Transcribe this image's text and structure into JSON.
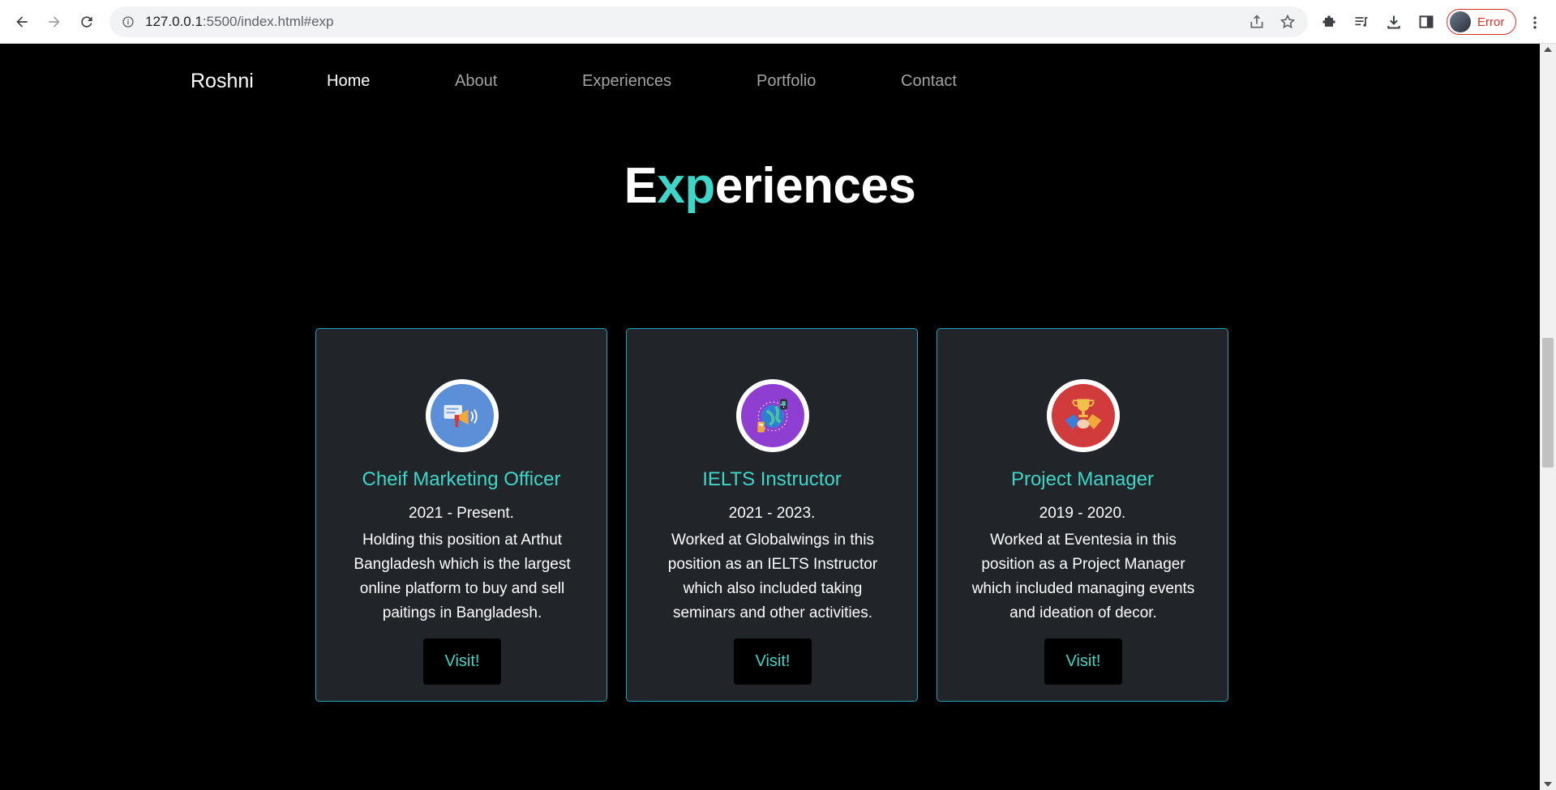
{
  "browser": {
    "url_host": "127.0.0.1",
    "url_path": ":5500/index.html#exp",
    "profile_label": "Error"
  },
  "site": {
    "brand": "Roshni",
    "nav": [
      {
        "label": "Home",
        "active": true
      },
      {
        "label": "About",
        "active": false
      },
      {
        "label": "Experiences",
        "active": false
      },
      {
        "label": "Portfolio",
        "active": false
      },
      {
        "label": "Contact",
        "active": false
      }
    ]
  },
  "section": {
    "title_pre": "E",
    "title_accent": "xp",
    "title_post": "eriences"
  },
  "cards": [
    {
      "icon": "marketing-megaphone-icon",
      "icon_color": "#5b8fd8",
      "title": "Cheif Marketing Officer",
      "period": "2021 - Present.",
      "description": "Holding this position at Arthut Bangladesh which is the largest online platform to buy and sell paitings in Bangladesh.",
      "button": "Visit!"
    },
    {
      "icon": "globe-instructor-icon",
      "icon_color": "#8e3fd1",
      "title": "IELTS Instructor",
      "period": "2021 - 2023.",
      "description": "Worked at Globalwings in this position as an IELTS Instructor which also included taking seminars and other activities.",
      "button": "Visit!"
    },
    {
      "icon": "trophy-handshake-icon",
      "icon_color": "#d23b3b",
      "title": "Project Manager",
      "period": "2019 - 2020.",
      "description": "Worked at Eventesia in this position as a Project Manager which included managing events and ideation of decor.",
      "button": "Visit!"
    }
  ],
  "colors": {
    "accent": "#3ed6c8",
    "card_bg": "#212529",
    "card_border": "#1ca6b8",
    "page_bg": "#000000"
  }
}
